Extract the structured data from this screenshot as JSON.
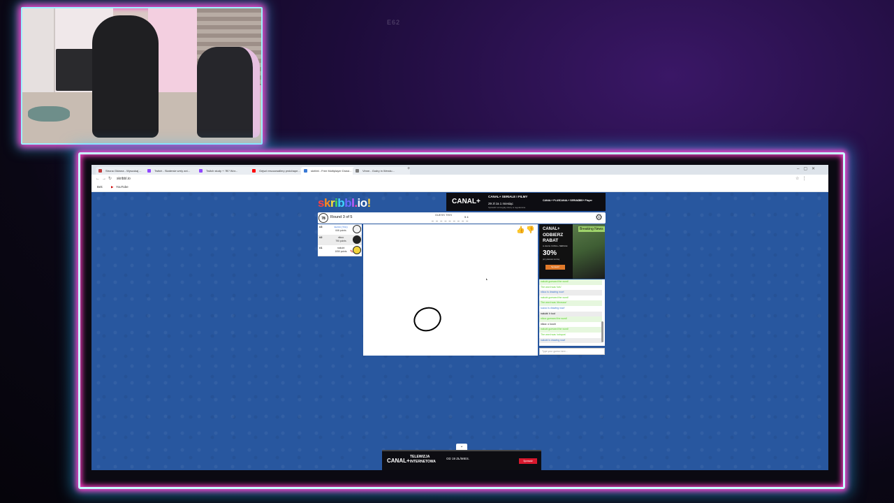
{
  "overlay": {
    "top_text": "E62"
  },
  "browser": {
    "tabs": [
      {
        "label": "Strona Główna - Wyszukaj ...",
        "color": "#c23b3b"
      },
      {
        "label": "Twitch - Skatersie wrriy ani...",
        "color": "#9146ff"
      },
      {
        "label": "Twitch study + ?B? Wor...",
        "color": "#9146ff"
      },
      {
        "label": "Gejszi rescuowallery prstchape...",
        "color": "#ff0000"
      },
      {
        "label": "skribbl - Free Multiplayer Drawi...",
        "color": "#3b7bd6"
      },
      {
        "label": "Vimm - Godry in Wendu...",
        "color": "#7d7d7d"
      }
    ],
    "url": "skribbl.io",
    "bookmarks": [
      "Bek",
      "YouTube"
    ]
  },
  "logo": [
    "s",
    "k",
    "r",
    "i",
    "b",
    "b",
    "l",
    ".",
    "i",
    "o",
    "!"
  ],
  "top_ad": {
    "brand": "CANAL+",
    "line1": "CANAL+ SERIALE I FILMY",
    "line2": "29 zł za 1 miesiąc",
    "line3": "Sprawdź szczegóły oferty w regulaminie",
    "logos": [
      "CANAL+ PLUS",
      "CANAL+ SERIALE",
      "CBS+ Player"
    ]
  },
  "game": {
    "timer": "78",
    "round": "Round 3 of 5",
    "guess_label": "GUESS THIS",
    "word_hint": "_ _ _ _ _  _ _ _ _",
    "word_count": "5 4",
    "settings_icon": "gear-icon"
  },
  "players": [
    {
      "rank": "#3",
      "name": "suzoo (You)",
      "points": "646 points",
      "you": true,
      "avatar": "#f3f3f3"
    },
    {
      "rank": "#2",
      "name": "nikoo",
      "points": "790 points",
      "you": false,
      "avatar": "#222"
    },
    {
      "rank": "#1",
      "name": "nakubi",
      "points": "1050 points",
      "you": false,
      "avatar": "#f2d33b",
      "drawing": true
    }
  ],
  "side_ad": {
    "l1": "CANAL+",
    "l2": "ODBIERZ",
    "l3": "RABAT",
    "l4": "w ofercie CANAL+ SERIALE",
    "pct": "30%",
    "l6": "przy płatności rocznej",
    "btn": "Sprawdź",
    "show": "Breaking News"
  },
  "chat": [
    {
      "text": "nakubi guessed the word!",
      "style": "green",
      "shade": "gshade"
    },
    {
      "text": "The word was 'tofu'",
      "style": "green",
      "shade": ""
    },
    {
      "text": "nikoo is drawing now!",
      "style": "blue",
      "shade": "shade"
    },
    {
      "text": "nakubi guessed the word!",
      "style": "green",
      "shade": ""
    },
    {
      "text": "The word was 'dinosaur'",
      "style": "green",
      "shade": "gshade"
    },
    {
      "text": "suzoo is drawing now!",
      "style": "blue",
      "shade": ""
    },
    {
      "text": "nakubi: h tout",
      "style": "black",
      "shade": "shade"
    },
    {
      "text": "nikoo guessed the word!",
      "style": "green",
      "shade": "gshade"
    },
    {
      "text": "nikoo: o loooh",
      "style": "black",
      "shade": ""
    },
    {
      "text": "nakubi guessed the word!",
      "style": "green",
      "shade": "gshade"
    },
    {
      "text": "The word was 'octopus'",
      "style": "green",
      "shade": ""
    },
    {
      "text": "nakubi is drawing now!",
      "style": "blue",
      "shade": "shade"
    }
  ],
  "chat_input_placeholder": "Type your guess here...",
  "bottom_ad": {
    "brand": "CANAL+",
    "t1": "TELEWIZJA",
    "t2": "INTERNETOWA",
    "price": "OD 19 ZŁ/MIES.",
    "cta": "Sprawdź"
  },
  "colors": {
    "like": "#48c047",
    "dislike": "#e04545",
    "page_bg": "#2a5aa6"
  }
}
